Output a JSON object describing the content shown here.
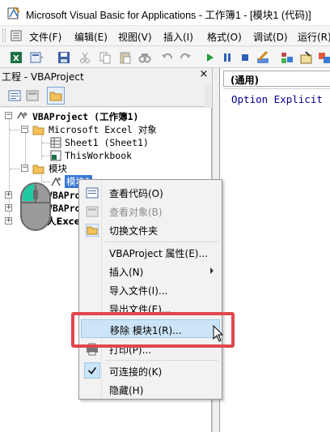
{
  "window": {
    "title": "Microsoft Visual Basic for Applications - 工作簿1 - [模块1 (代码)]"
  },
  "menubar": {
    "items": [
      {
        "label": "文件(F)"
      },
      {
        "label": "编辑(E)"
      },
      {
        "label": "视图(V)"
      },
      {
        "label": "插入(I)"
      },
      {
        "label": "格式(O)"
      },
      {
        "label": "调试(D)"
      },
      {
        "label": "运行(R)"
      }
    ]
  },
  "toolbar": {
    "icons": [
      "excel-icon",
      "insert-module-icon",
      "save-icon",
      "cut-icon",
      "copy-icon",
      "paste-icon",
      "find-icon",
      "undo-icon",
      "redo-icon",
      "run-icon",
      "break-icon",
      "reset-icon",
      "design-mode-icon",
      "project-explorer-icon",
      "properties-icon",
      "object-browser-icon"
    ]
  },
  "project_panel": {
    "title": "工程 - VBAProject",
    "close": "×"
  },
  "tree": {
    "root": "VBAProject (工作簿1)",
    "excel_objects_folder": "Microsoft Excel 对象",
    "sheet1": "Sheet1 (Sheet1)",
    "thisworkbook": "ThisWorkbook",
    "modules_folder": "模块",
    "module1": "模块1",
    "other_project_1": "VBAProje",
    "other_project_2": "VBAProje",
    "other_project_3": "人Excel"
  },
  "code_pane": {
    "combo_value": "(通用)",
    "code": "Option Explicit"
  },
  "context_menu": {
    "items": [
      {
        "label": "查看代码(O)",
        "icon": "view-code-icon",
        "disabled": false
      },
      {
        "label": "查看对象(B)",
        "icon": "view-object-icon",
        "disabled": true
      },
      {
        "label": "切换文件夹",
        "icon": "toggle-folders-icon",
        "disabled": false
      },
      {
        "label": "VBAProject 属性(E)...",
        "disabled": false
      },
      {
        "label": "插入(N)",
        "disabled": false,
        "submenu": true
      },
      {
        "label": "导入文件(I)...",
        "disabled": false
      },
      {
        "label": "导出文件(E)...",
        "disabled": false
      },
      {
        "label": "移除 模块1(R)...",
        "disabled": false,
        "highlighted": true
      },
      {
        "label": "打印(P)...",
        "icon": "print-icon",
        "disabled": false
      },
      {
        "label": "可连接的(K)",
        "icon": "check-icon",
        "disabled": false,
        "checked": true
      },
      {
        "label": "隐藏(H)",
        "disabled": false
      }
    ]
  },
  "colors": {
    "highlight_box": "#e0474c",
    "menu_hover": "#cce4f7",
    "code_keyword": "#00008b"
  }
}
